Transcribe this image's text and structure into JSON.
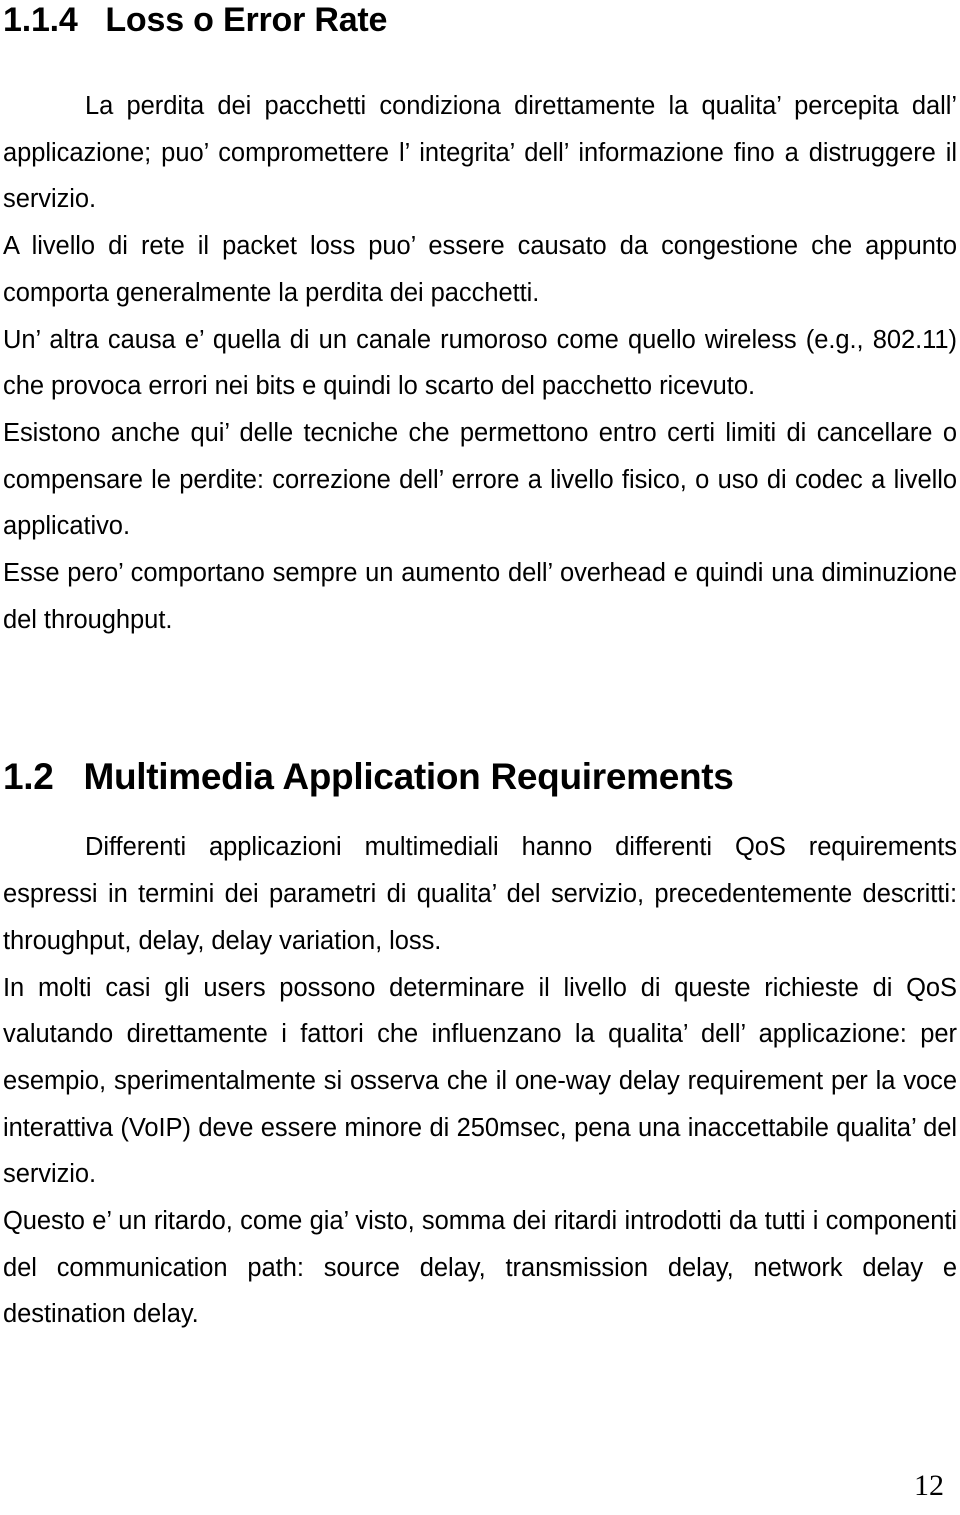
{
  "document": {
    "page_number": "12",
    "language": "it",
    "sections": [
      {
        "id": "loss-error-rate",
        "number": "1.1.4",
        "title": "Loss o Error Rate",
        "heading_text": "1.1.4   Loss o Error Rate",
        "level": 3,
        "paragraphs": [
          {
            "id": "p1",
            "indent": true,
            "text": "La perdita dei pacchetti condiziona direttamente la qualita’ percepita dall’ applicazione; puo’ compromettere l’ integrita’ dell’ informazione fino a distruggere il servizio."
          },
          {
            "id": "p2",
            "indent": false,
            "text": "A livello di rete il packet loss puo’ essere causato da congestione che appunto comporta generalmente la perdita dei pacchetti."
          },
          {
            "id": "p3",
            "indent": false,
            "text": "Un’ altra causa e’ quella di un canale rumoroso come quello wireless (e.g., 802.11) che provoca errori nei bits e quindi lo scarto del pacchetto ricevuto."
          },
          {
            "id": "p4",
            "indent": false,
            "text": "Esistono anche qui’ delle tecniche che permettono entro certi limiti di cancellare o compensare le perdite: correzione dell’ errore a livello fisico, o uso di codec a livello applicativo."
          },
          {
            "id": "p5",
            "indent": false,
            "text": "Esse pero’ comportano sempre un aumento dell’ overhead e quindi una diminuzione del throughput."
          }
        ]
      },
      {
        "id": "multimedia-application-requirements",
        "number": "1.2",
        "title": "Multimedia Application Requirements",
        "heading_text": "1.2   Multimedia Application Requirements",
        "level": 2,
        "paragraphs": [
          {
            "id": "p6",
            "indent": true,
            "text": "Differenti applicazioni multimediali hanno differenti QoS requirements espressi in termini dei parametri di qualita’ del servizio, precedentemente descritti: throughput, delay, delay variation, loss."
          },
          {
            "id": "p7",
            "indent": false,
            "text": "In molti casi gli users possono determinare il livello di queste richieste di QoS valutando direttamente i fattori che influenzano la qualita’ dell’ applicazione: per esempio, sperimentalmente si osserva che il one-way delay requirement per la voce interattiva (VoIP) deve essere minore di 250msec, pena una inaccettabile qualita’ del servizio."
          },
          {
            "id": "p8",
            "indent": false,
            "text": "Questo e’ un ritardo, come gia’ visto, somma dei ritardi introdotti da tutti i componenti del communication path: source delay, transmission delay, network delay e destination delay."
          }
        ]
      }
    ]
  },
  "colors": {
    "page_background": "#ffffff",
    "text": "#000000"
  }
}
